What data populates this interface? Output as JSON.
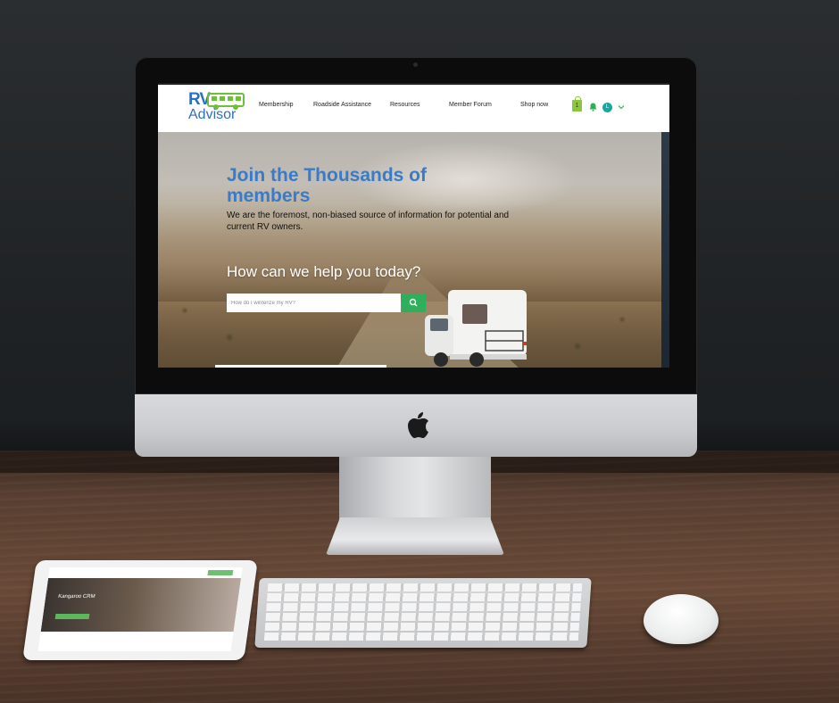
{
  "colors": {
    "brand_blue": "#3a7bc8",
    "search_green": "#2fae5c",
    "cart_green": "#8cc63f",
    "avatar_teal": "#1aa6a0"
  },
  "site": {
    "logo_top": "RV",
    "logo_bottom": "Advisor",
    "nav": [
      "Membership",
      "Roadside Assistance",
      "Resources",
      "Member Forum",
      "Shop now"
    ],
    "cart_count": "1",
    "user_initial": "L",
    "icons": {
      "cart": "shopping-bag-icon",
      "notifications": "bell-icon",
      "dropdown": "chevron-down-icon",
      "search": "search-icon"
    }
  },
  "hero": {
    "title": "Join the Thousands of members",
    "subtitle": "We are the foremost, non-biased source of information for potential and current RV owners.",
    "help_heading": "How can we help you today?",
    "search_placeholder": "How do I winterize my RV?"
  },
  "tablet": {
    "hero_text": "Kangaroo CRM"
  }
}
